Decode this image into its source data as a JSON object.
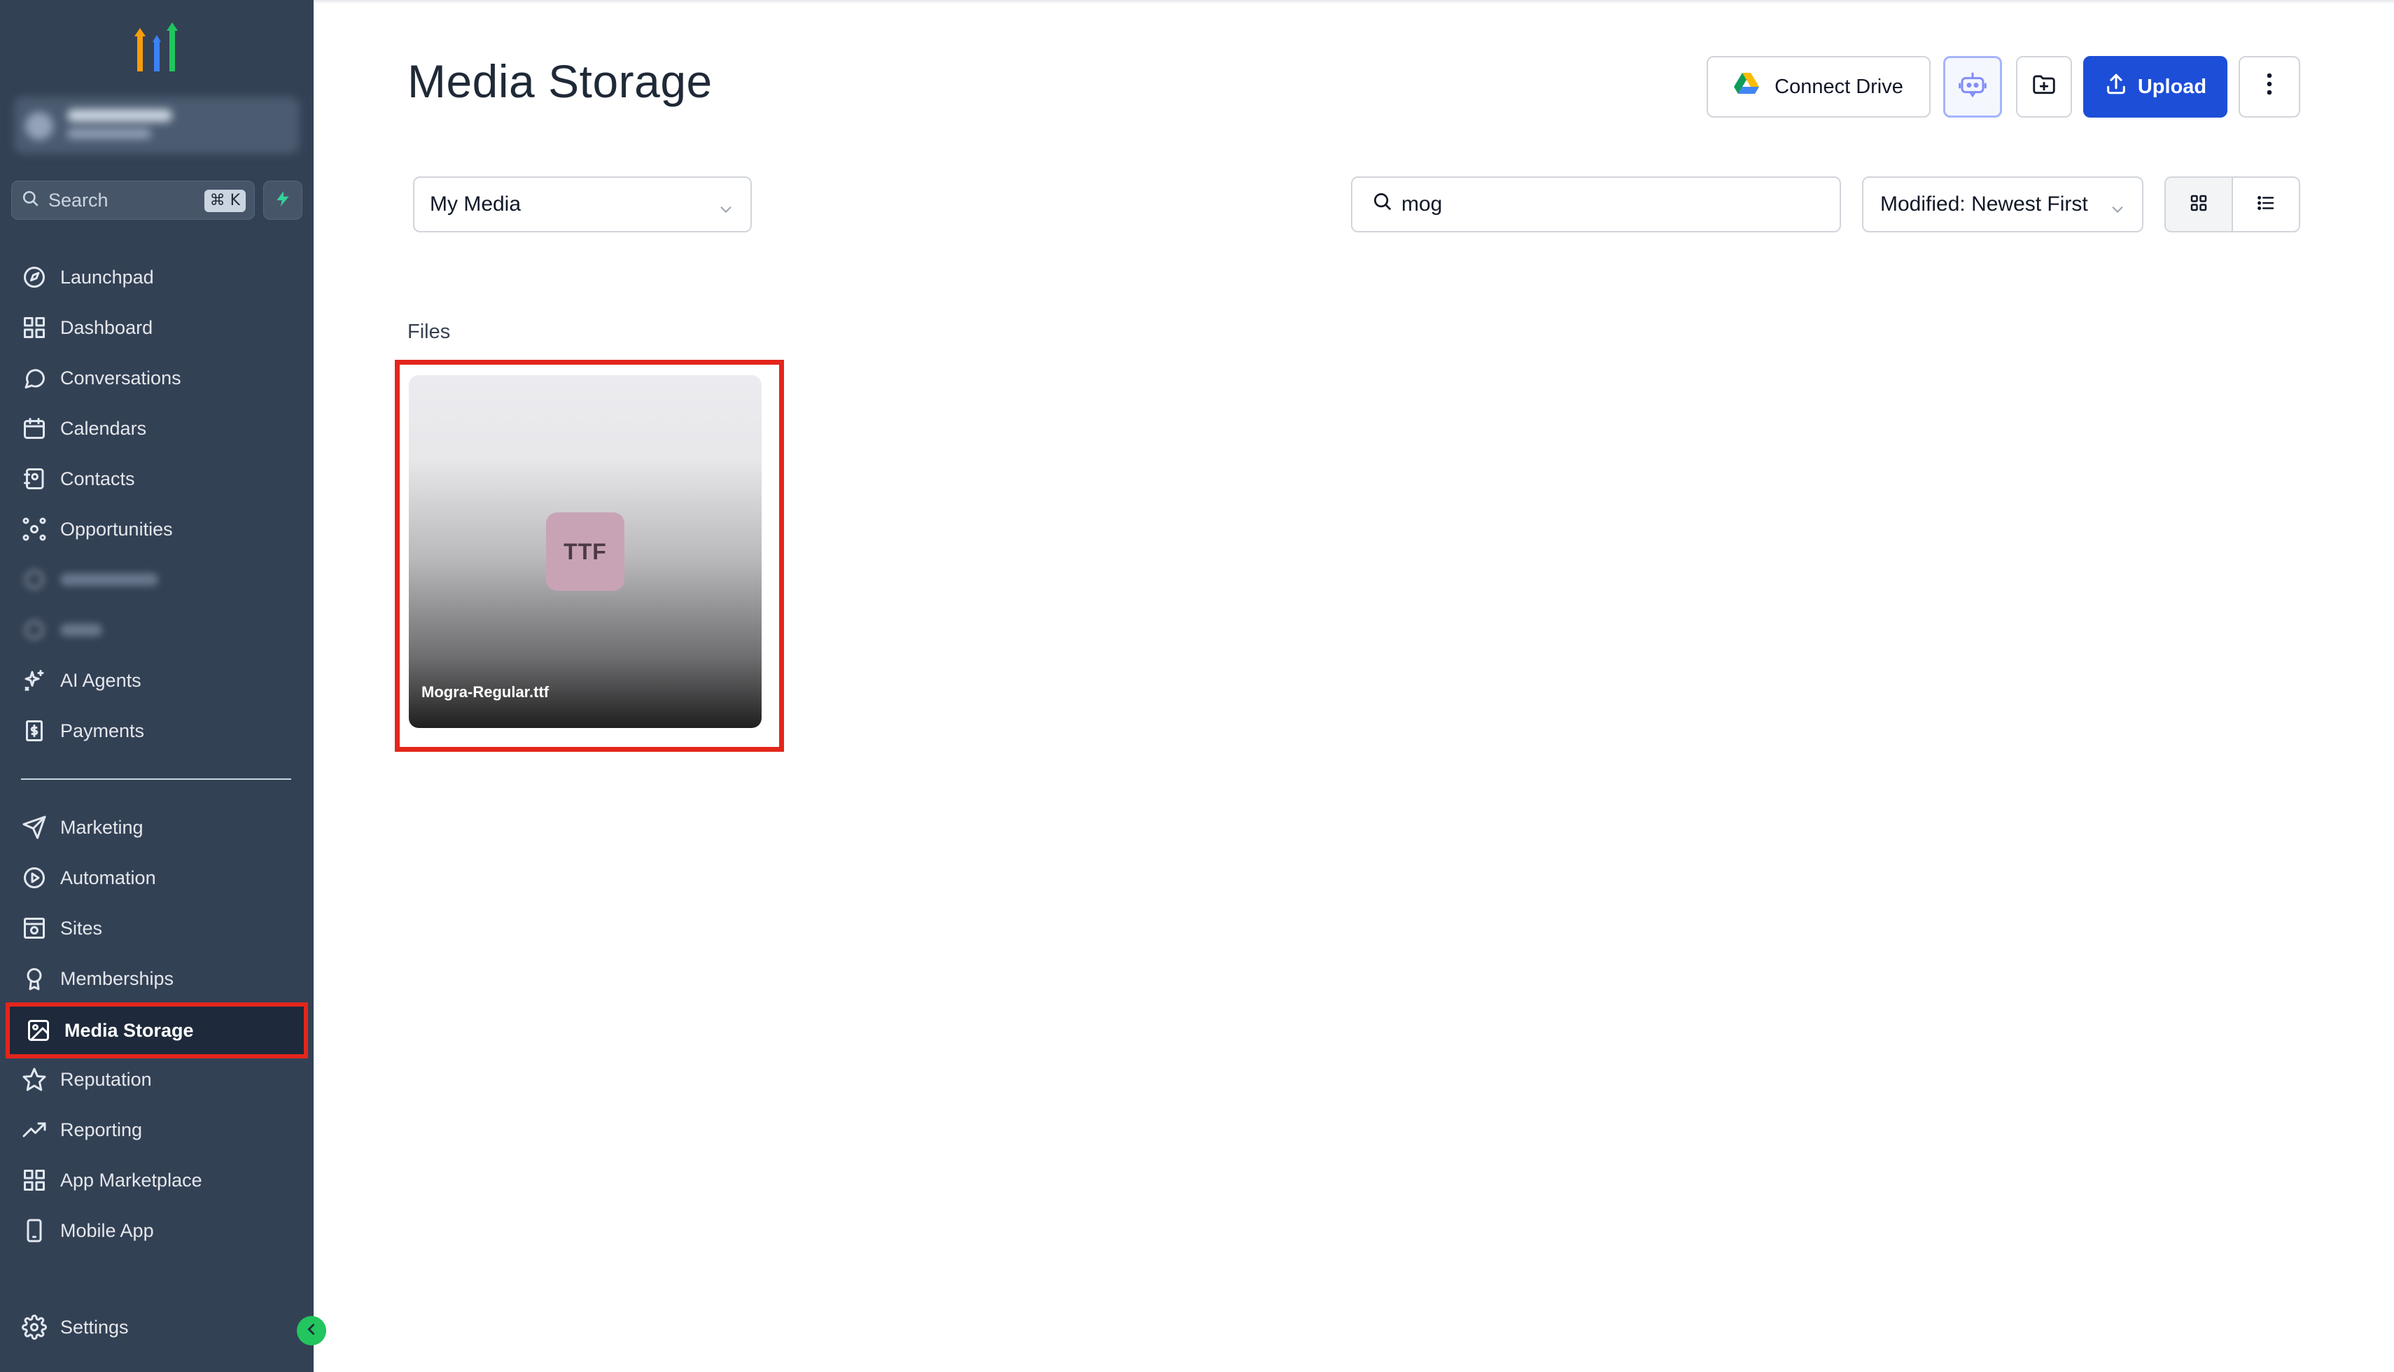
{
  "sidebar": {
    "search": {
      "label": "Search",
      "shortcut": "⌘ K"
    },
    "items_top": [
      {
        "label": "Launchpad",
        "icon": "rocket-icon"
      },
      {
        "label": "Dashboard",
        "icon": "grid-icon"
      },
      {
        "label": "Conversations",
        "icon": "chat-icon"
      },
      {
        "label": "Calendars",
        "icon": "calendar-icon"
      },
      {
        "label": "Contacts",
        "icon": "contacts-icon"
      },
      {
        "label": "Opportunities",
        "icon": "opportunities-icon"
      },
      {
        "label": "",
        "icon": "blurred-icon"
      },
      {
        "label": "",
        "icon": "blurred-icon"
      },
      {
        "label": "AI Agents",
        "icon": "sparkle-icon"
      },
      {
        "label": "Payments",
        "icon": "receipt-icon"
      }
    ],
    "items_bottom": [
      {
        "label": "Marketing",
        "icon": "send-icon"
      },
      {
        "label": "Automation",
        "icon": "automation-icon"
      },
      {
        "label": "Sites",
        "icon": "sites-icon"
      },
      {
        "label": "Memberships",
        "icon": "badge-icon"
      },
      {
        "label": "Media Storage",
        "icon": "image-icon",
        "active": true
      },
      {
        "label": "Reputation",
        "icon": "star-icon"
      },
      {
        "label": "Reporting",
        "icon": "trend-icon"
      },
      {
        "label": "App Marketplace",
        "icon": "grid-icon"
      },
      {
        "label": "Mobile App",
        "icon": "phone-icon"
      }
    ],
    "settings_label": "Settings"
  },
  "header": {
    "title": "Media Storage",
    "connect_drive_label": "Connect Drive",
    "upload_label": "Upload"
  },
  "filters": {
    "media_select": "My Media",
    "search_value": "mog",
    "sort_select": "Modified: Newest First"
  },
  "files": {
    "section_label": "Files",
    "items": [
      {
        "name": "Mogra-Regular.ttf",
        "type_badge": "TTF"
      }
    ]
  },
  "colors": {
    "sidebar_bg": "#334155",
    "accent": "#1d4ed8",
    "highlight": "#e3261c",
    "ttf_badge": "#c8a3b6"
  }
}
